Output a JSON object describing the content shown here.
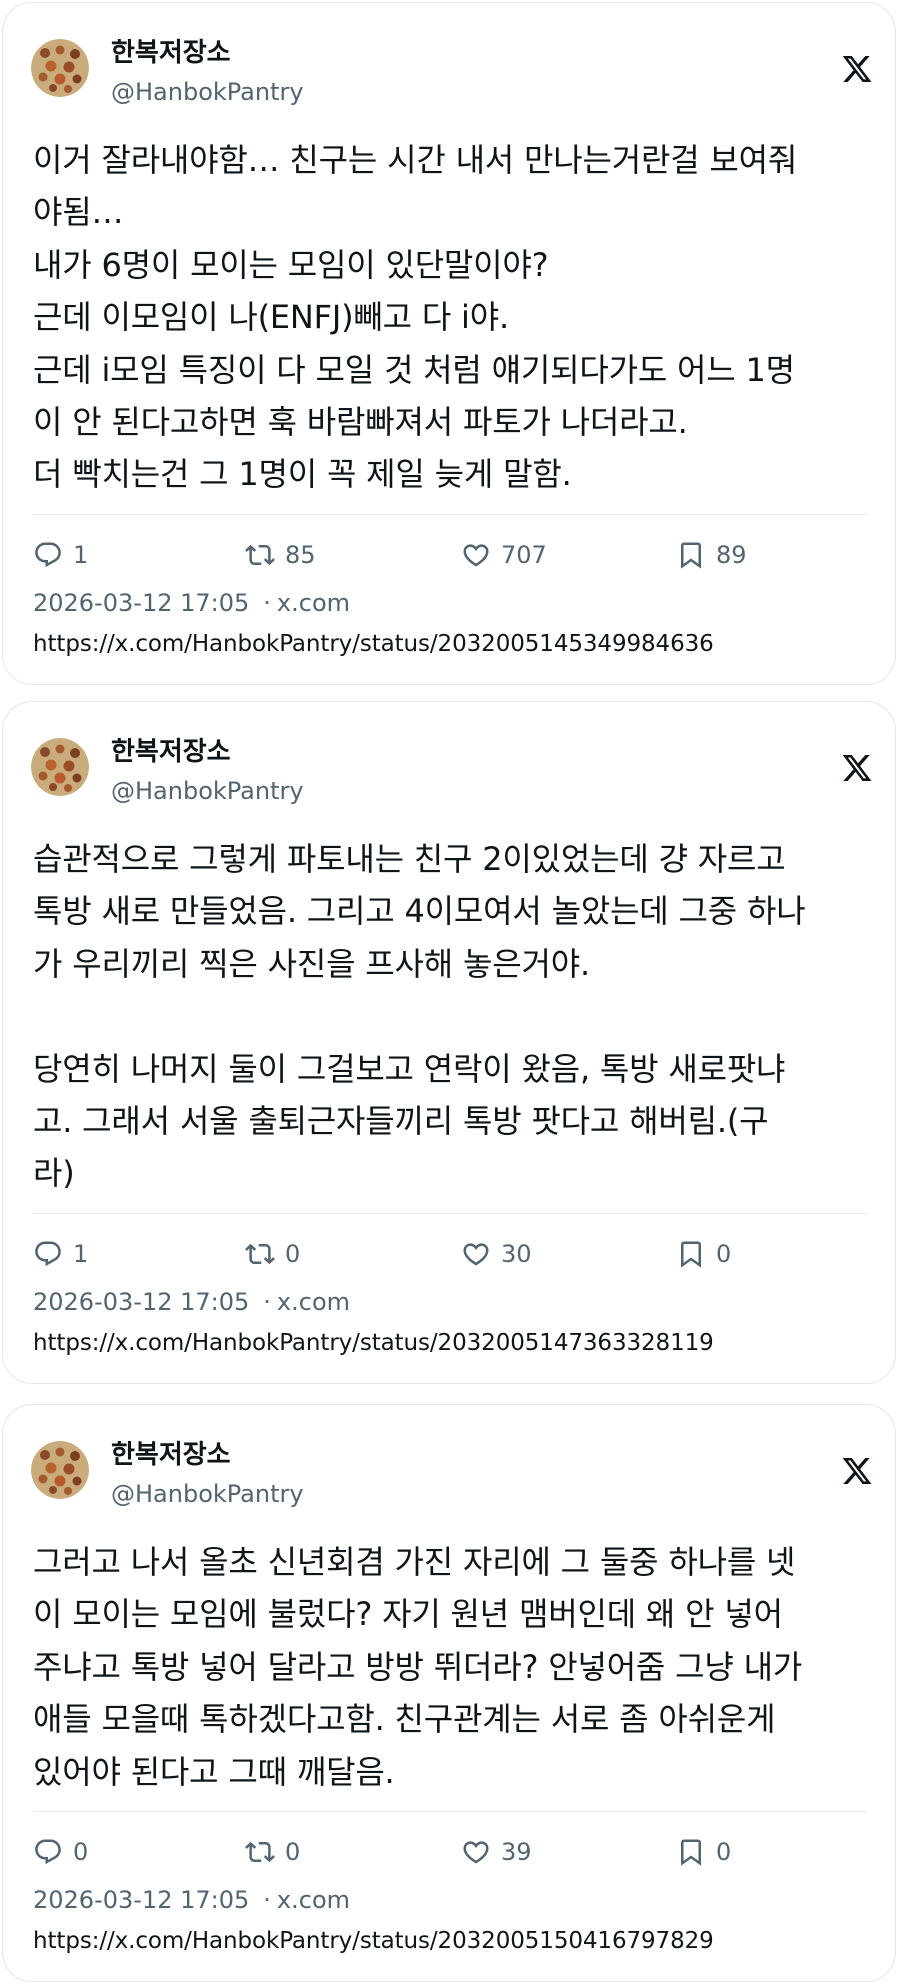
{
  "tweets": [
    {
      "display_name": "한복저장소",
      "handle": "@HanbokPantry",
      "text": "이거 잘라내야함… 친구는 시간 내서 만나는거란걸 보여줘\n야됨…\n내가 6명이 모이는 모임이 있단말이야?\n근데 이모임이 나(ENFJ)빼고 다 i야.\n근데 i모임 특징이 다 모일 것 처럼 얘기되다가도 어느 1명\n이 안 된다고하면 훅 바람빠져서 파토가 나더라고.\n더 빡치는건 그 1명이 꼭 제일 늦게 말함.",
      "replies": "1",
      "reposts": "85",
      "likes": "707",
      "bookmarks": "89",
      "timestamp": "2026-03-12 17:05",
      "source": "x.com",
      "url": "https://x.com/HanbokPantry/status/2032005145349984636"
    },
    {
      "display_name": "한복저장소",
      "handle": "@HanbokPantry",
      "text": "습관적으로 그렇게 파토내는 친구 2이있었는데 걍 자르고\n톡방 새로 만들었음. 그리고 4이모여서 놀았는데 그중 하나\n가 우리끼리 찍은 사진을 프사해 놓은거야.\n\n당연히 나머지 둘이 그걸보고 연락이 왔음, 톡방 새로팟냐\n고. 그래서 서울 출퇴근자들끼리 톡방 팟다고 해버림.(구\n라)",
      "replies": "1",
      "reposts": "0",
      "likes": "30",
      "bookmarks": "0",
      "timestamp": "2026-03-12 17:05",
      "source": "x.com",
      "url": "https://x.com/HanbokPantry/status/2032005147363328119"
    },
    {
      "display_name": "한복저장소",
      "handle": "@HanbokPantry",
      "text": "그러고 나서 올초 신년회겸 가진 자리에 그 둘중 하나를 넷\n이 모이는 모임에 불렀다? 자기 원년 맴버인데 왜 안 넣어\n주냐고 톡방 넣어 달라고 방방 뛰더라? 안넣어줌 그냥 내가\n애들 모을때 톡하겠다고함. 친구관계는 서로 좀 아쉬운게\n있어야 된다고 그때 깨달음.",
      "replies": "0",
      "reposts": "0",
      "likes": "39",
      "bookmarks": "0",
      "timestamp": "2026-03-12 17:05",
      "source": "x.com",
      "url": "https://x.com/HanbokPantry/status/2032005150416797829"
    }
  ],
  "icons": {
    "reply": "reply-icon",
    "repost": "repost-icon",
    "like": "heart-icon",
    "bookmark": "bookmark-icon",
    "brand": "x-logo-icon"
  },
  "colors": {
    "text": "#0f1419",
    "muted": "#536471",
    "border": "#e3e6ea"
  }
}
